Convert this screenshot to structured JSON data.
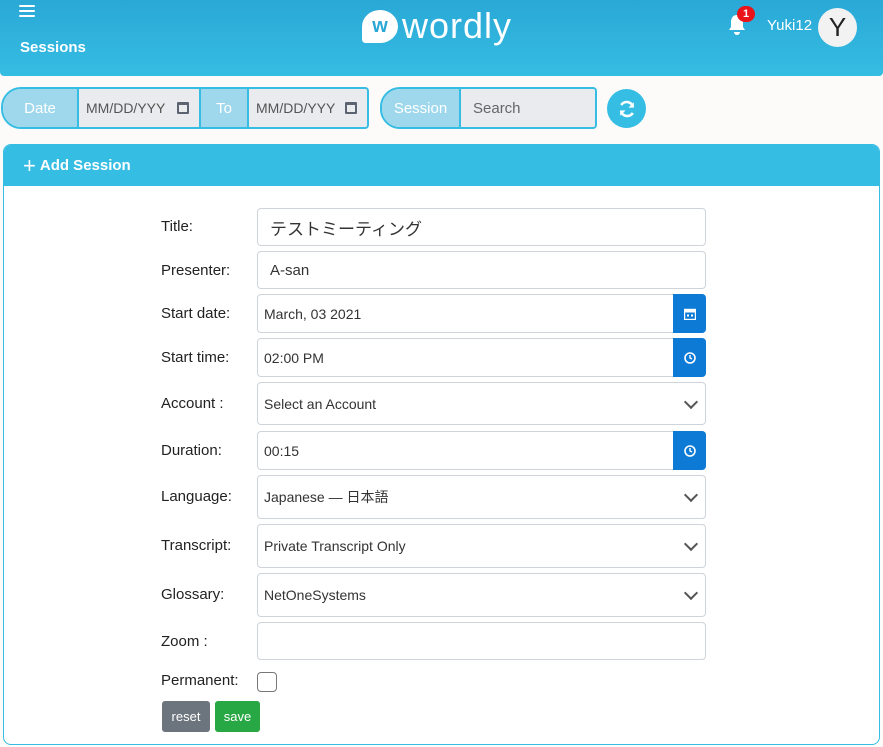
{
  "header": {
    "page_title": "Sessions",
    "logo_letter": "w",
    "logo_text": "wordly",
    "notification_count": "1",
    "username": "Yuki12",
    "avatar_initial": "Y"
  },
  "filters": {
    "date_label": "Date",
    "from_placeholder": "MM/DD/YYY",
    "to_label": "To",
    "to_placeholder": "MM/DD/YYY",
    "session_label": "Session",
    "search_placeholder": "Search"
  },
  "panel": {
    "title": "Add Session"
  },
  "form": {
    "title_label": "Title:",
    "title_value": "テストミーティング",
    "presenter_label": "Presenter:",
    "presenter_value": "A-san",
    "start_date_label": "Start date:",
    "start_date_value": "March, 03 2021",
    "start_time_label": "Start time:",
    "start_time_value": "02:00 PM",
    "account_label": "Account :",
    "account_value": "Select an Account",
    "duration_label": "Duration:",
    "duration_value": "00:15",
    "language_label": "Language:",
    "language_value": "Japanese — 日本語",
    "transcript_label": "Transcript:",
    "transcript_value": "Private Transcript Only",
    "glossary_label": "Glossary:",
    "glossary_value": "NetOneSystems",
    "zoom_label": "Zoom :",
    "zoom_value": "",
    "permanent_label": "Permanent:",
    "reset_label": "reset",
    "save_label": "save"
  },
  "colors": {
    "brand": "#35bde3",
    "addon": "#0d7bd6",
    "reset": "#6c757d",
    "save": "#28a745",
    "badge": "#e8141a"
  }
}
